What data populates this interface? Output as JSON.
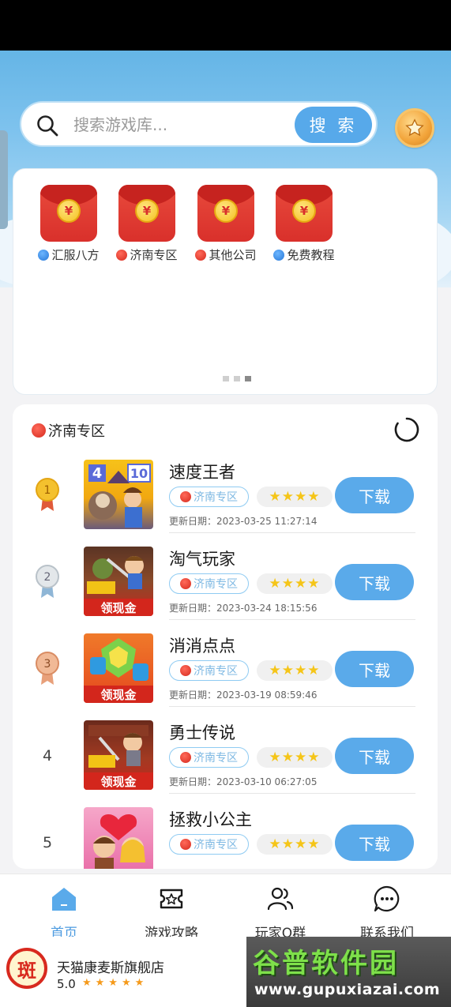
{
  "search": {
    "placeholder": "搜索游戏库...",
    "button_label": "搜 索"
  },
  "shortcuts": [
    {
      "label": "汇服八方",
      "dot": "blue",
      "symbol": "¥"
    },
    {
      "label": "济南专区",
      "dot": "red",
      "symbol": "¥"
    },
    {
      "label": "其他公司",
      "dot": "red",
      "symbol": "¥"
    },
    {
      "label": "免费教程",
      "dot": "blue",
      "symbol": "¥"
    }
  ],
  "list": {
    "title": "济南专区",
    "games": [
      {
        "rank": "1",
        "title": "速度王者",
        "region": "济南专区",
        "stars": "★★★★",
        "updated": "更新日期：2023-03-25 11:27:14",
        "button": "下载"
      },
      {
        "rank": "2",
        "title": "淘气玩家",
        "region": "济南专区",
        "stars": "★★★★",
        "updated": "更新日期：2023-03-24 18:15:56",
        "button": "下载"
      },
      {
        "rank": "3",
        "title": "消消点点",
        "region": "济南专区",
        "stars": "★★★★",
        "updated": "更新日期：2023-03-19 08:59:46",
        "button": "下载"
      },
      {
        "rank": "4",
        "title": "勇士传说",
        "region": "济南专区",
        "stars": "★★★★",
        "updated": "更新日期：2023-03-10 06:27:05",
        "button": "下载"
      },
      {
        "rank": "5",
        "title": "拯救小公主",
        "region": "济南专区",
        "stars": "★★★★",
        "updated": "",
        "button": "下载"
      }
    ],
    "thumb_texts": {
      "t1_a": "4",
      "t1_b": "10",
      "t2": "领现金",
      "t3": "领现金",
      "t4": "领现金"
    }
  },
  "nav": [
    {
      "label": "首页",
      "icon": "home-icon",
      "active": true
    },
    {
      "label": "游戏攻略",
      "icon": "ticket-icon",
      "active": false
    },
    {
      "label": "玩家Q群",
      "icon": "users-icon",
      "active": false
    },
    {
      "label": "联系我们",
      "icon": "chat-icon",
      "active": false
    }
  ],
  "ad": {
    "shop_name": "天猫康麦斯旗舰店",
    "score": "5.0",
    "stars": "★★★★★",
    "logo_text": "斑"
  },
  "watermark": {
    "title": "谷普软件园",
    "url": "www.gupuxiazai.com"
  },
  "colors": {
    "accent": "#57a9ea",
    "red": "#d9302b",
    "star": "#f5c518"
  }
}
